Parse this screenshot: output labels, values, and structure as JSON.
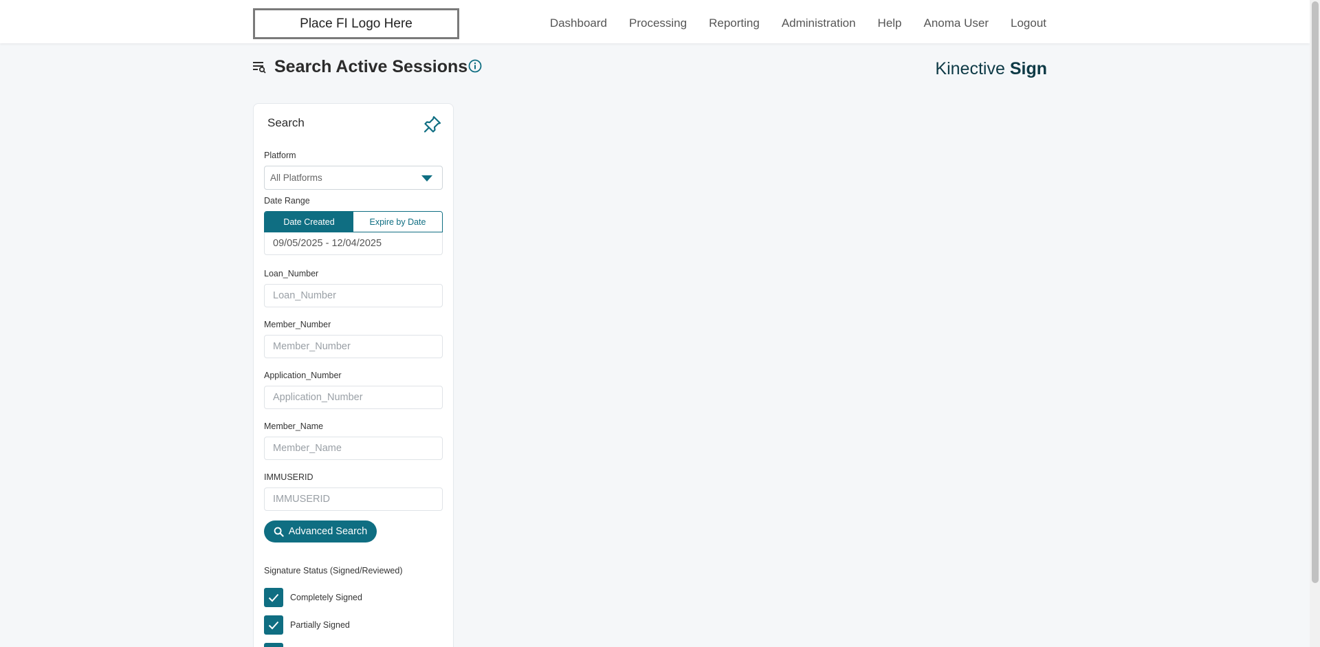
{
  "header": {
    "logo_text": "Place FI Logo Here",
    "nav": [
      "Dashboard",
      "Processing",
      "Reporting",
      "Administration",
      "Help",
      "Anoma User",
      "Logout"
    ]
  },
  "page": {
    "title": "Search Active Sessions",
    "brand_light": "Kinective",
    "brand_bold": "Sign"
  },
  "search_panel": {
    "title": "Search",
    "platform": {
      "label": "Platform",
      "value": "All Platforms"
    },
    "date_range": {
      "label": "Date Range",
      "tabs": [
        "Date Created",
        "Expire by Date"
      ],
      "active_tab": "Date Created",
      "value": "09/05/2025 - 12/04/2025"
    },
    "fields": [
      {
        "label": "Loan_Number",
        "placeholder": "Loan_Number"
      },
      {
        "label": "Member_Number",
        "placeholder": "Member_Number"
      },
      {
        "label": "Application_Number",
        "placeholder": "Application_Number"
      },
      {
        "label": "Member_Name",
        "placeholder": "Member_Name"
      },
      {
        "label": "IMMUSERID",
        "placeholder": "IMMUSERID"
      }
    ],
    "advanced_search_label": "Advanced Search",
    "signature_status": {
      "label": "Signature Status (Signed/Reviewed)",
      "options": [
        {
          "label": "Completely Signed",
          "checked": true
        },
        {
          "label": "Partially Signed",
          "checked": true
        }
      ]
    }
  },
  "colors": {
    "accent": "#0f6e82",
    "background": "#f5f7f9",
    "brand_text": "#0e3a46"
  },
  "icons": {
    "title": "search-list-icon",
    "info": "info-circle-icon",
    "pin": "pin-icon",
    "dropdown": "caret-down-icon",
    "search": "magnifier-icon",
    "check": "checkmark-icon"
  }
}
